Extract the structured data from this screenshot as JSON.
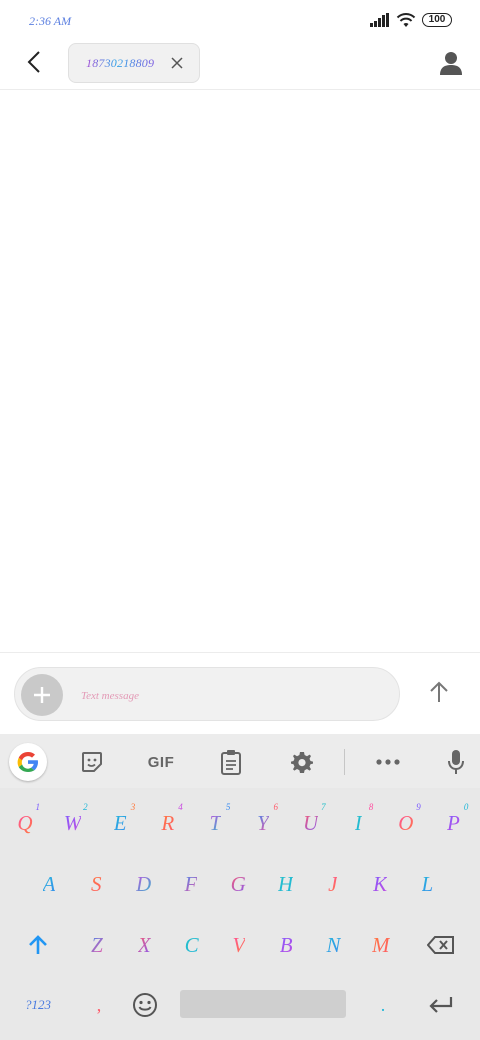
{
  "status_bar": {
    "time": "2:36 AM",
    "battery": "100"
  },
  "header": {
    "recipient": "18730218809"
  },
  "compose": {
    "placeholder": "Text message"
  },
  "keyboard": {
    "toolbar": {
      "gif": "GIF"
    },
    "row1": [
      {
        "char": "Q",
        "hint": "1"
      },
      {
        "char": "W",
        "hint": "2"
      },
      {
        "char": "E",
        "hint": "3"
      },
      {
        "char": "R",
        "hint": "4"
      },
      {
        "char": "T",
        "hint": "5"
      },
      {
        "char": "Y",
        "hint": "6"
      },
      {
        "char": "U",
        "hint": "7"
      },
      {
        "char": "I",
        "hint": "8"
      },
      {
        "char": "O",
        "hint": "9"
      },
      {
        "char": "P",
        "hint": "0"
      }
    ],
    "row2": [
      "A",
      "S",
      "D",
      "F",
      "G",
      "H",
      "J",
      "K",
      "L"
    ],
    "row3": [
      "Z",
      "X",
      "C",
      "V",
      "B",
      "N",
      "M"
    ],
    "row4": {
      "symbols": "?123",
      "comma": ",",
      "period": "."
    }
  },
  "colors": {
    "accent": "#2196f3",
    "key_gradients": [
      "#ff4fa0",
      "#7b5cff",
      "#20b7d8",
      "#ff7a3d",
      "#c94ce0",
      "#3b8cf0",
      "#ff5a6a",
      "#27c0c9"
    ]
  }
}
